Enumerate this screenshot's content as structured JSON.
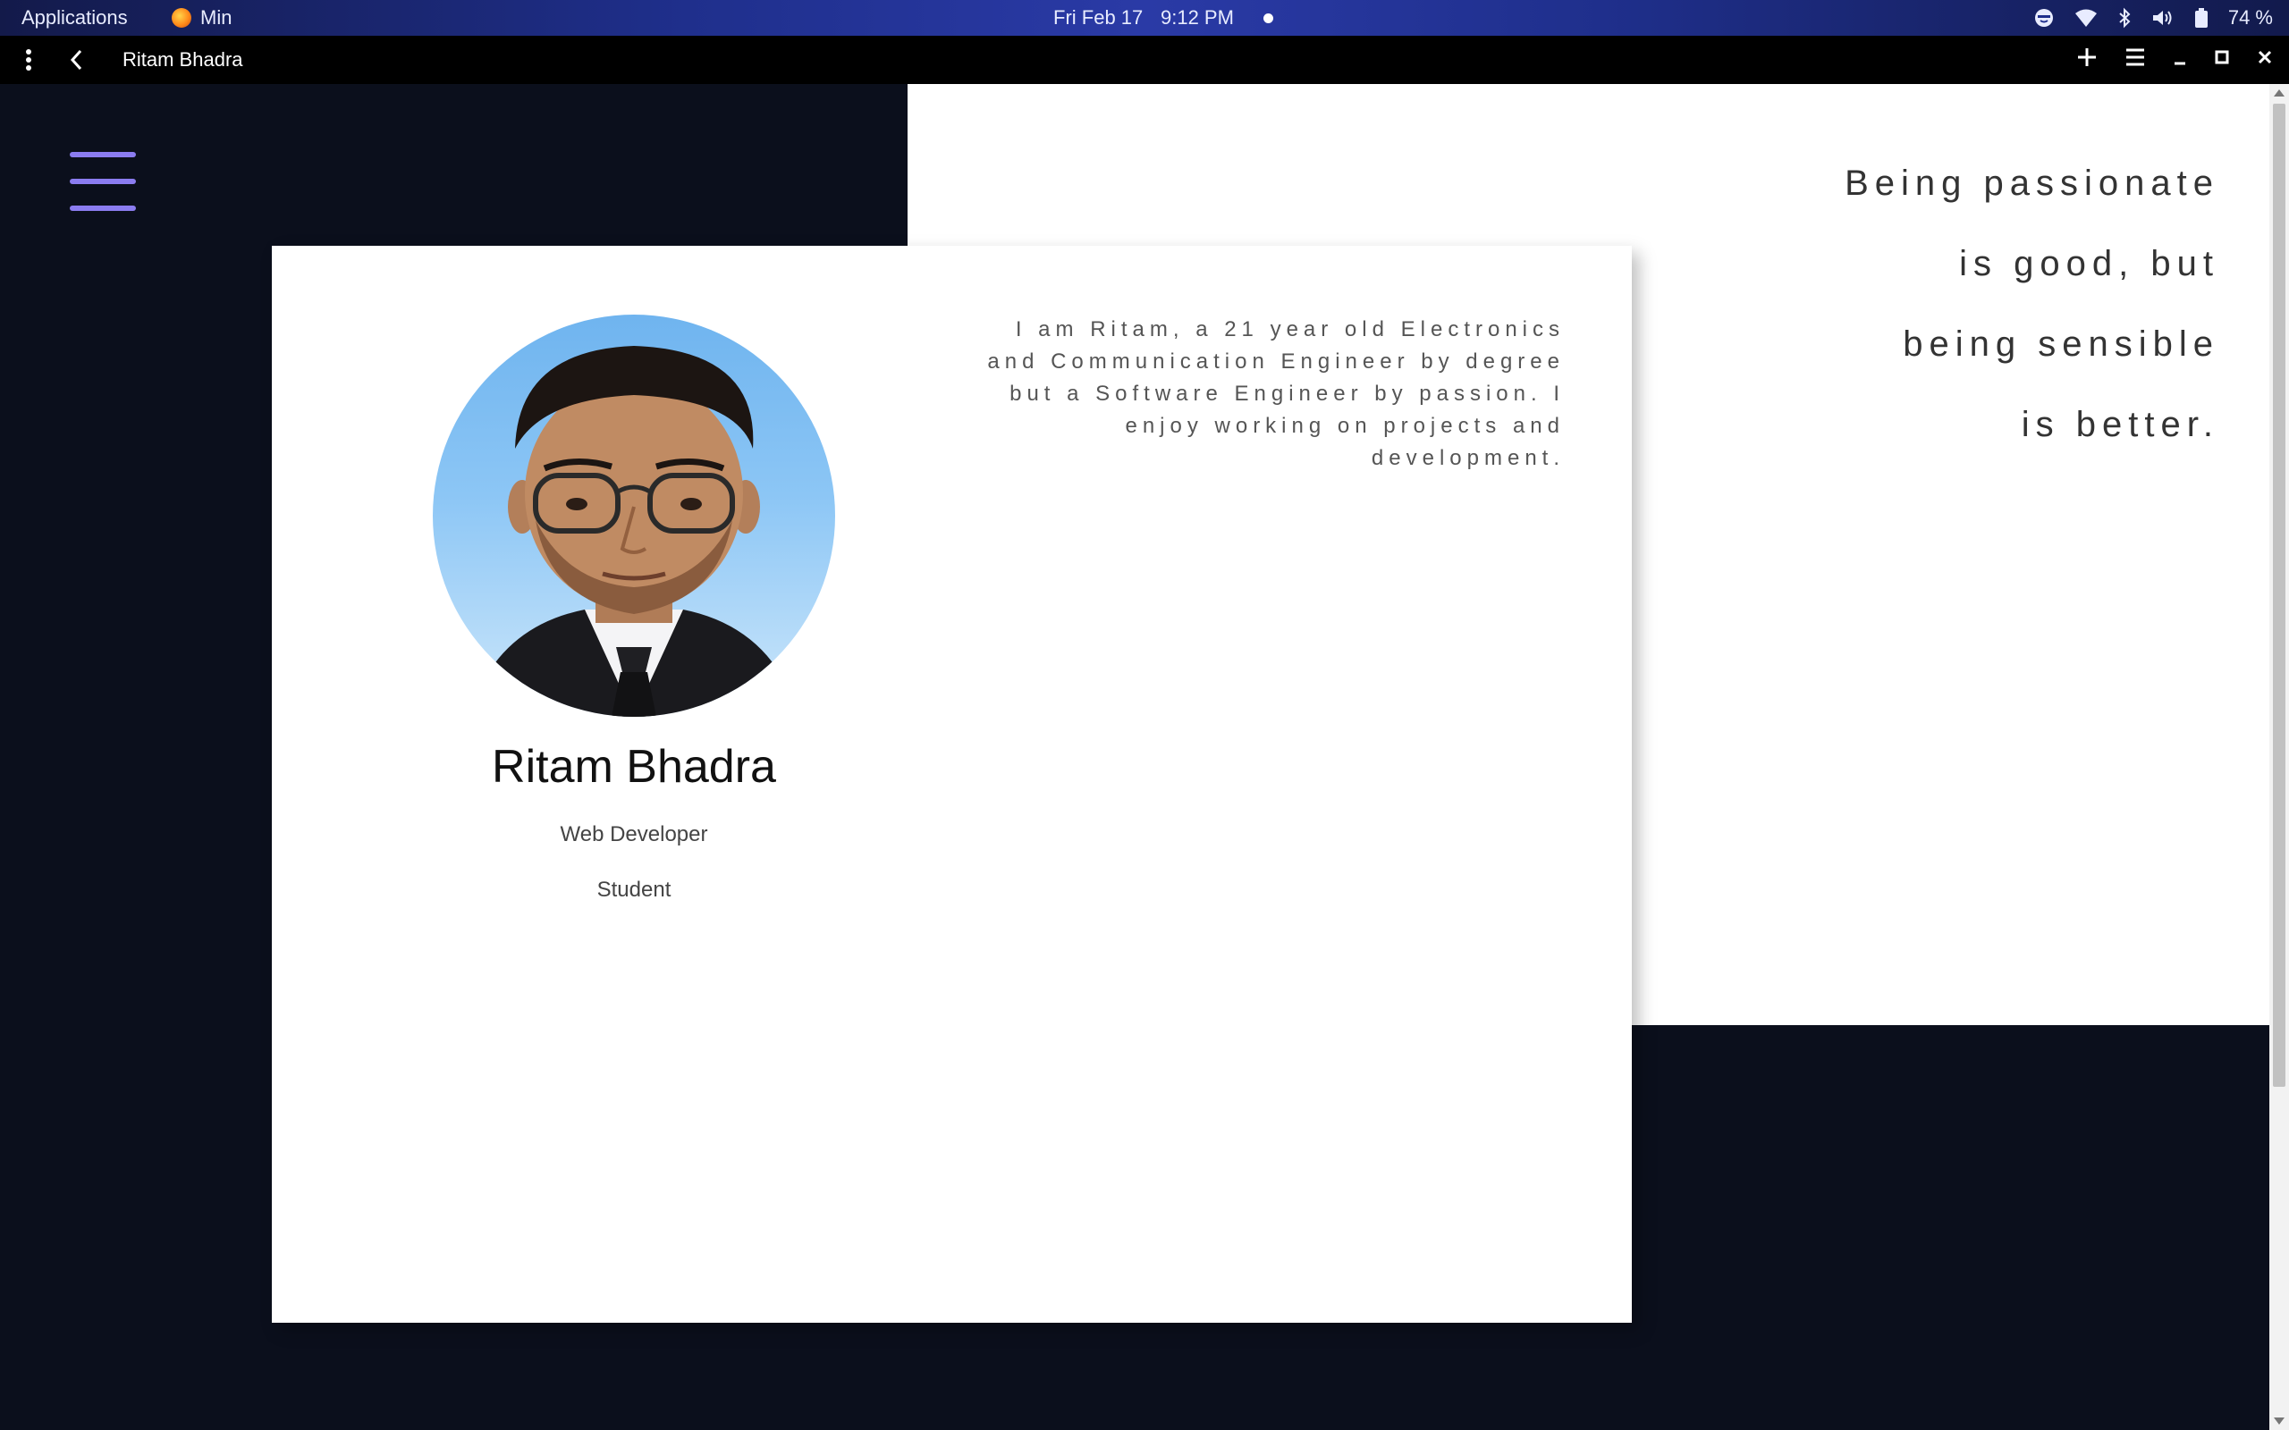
{
  "system_bar": {
    "applications_label": "Applications",
    "active_app": "Min",
    "date": "Fri Feb 17",
    "time": "9:12 PM",
    "battery": "74 %"
  },
  "browser": {
    "page_title": "Ritam Bhadra"
  },
  "profile": {
    "name": "Ritam Bhadra",
    "role": "Web Developer",
    "status": "Student",
    "bio": "I am Ritam, a 21 year old Electronics and Communication Engineer by degree but a Software Engineer by passion. I enjoy working on projects and development."
  },
  "quote": {
    "lines": [
      "Being passionate",
      "is good, but",
      "being sensible",
      "is better."
    ]
  },
  "colors": {
    "page_background": "#0b0f1c",
    "menu_accent": "#8b7cf0"
  }
}
